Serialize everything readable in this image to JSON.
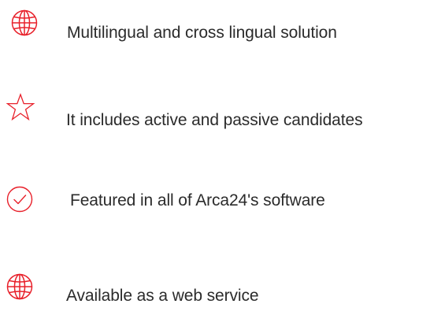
{
  "colors": {
    "icon_accent": "#e8202a",
    "text": "#2b2b2b",
    "background": "#ffffff"
  },
  "features": [
    {
      "icon": "globe-icon",
      "label": "Multilingual and cross lingual solution"
    },
    {
      "icon": "star-icon",
      "label": "It includes active and passive candidates"
    },
    {
      "icon": "check-circle-icon",
      "label": "Featured in all of Arca24's software"
    },
    {
      "icon": "globe-icon",
      "label": "Available as a web service"
    }
  ]
}
